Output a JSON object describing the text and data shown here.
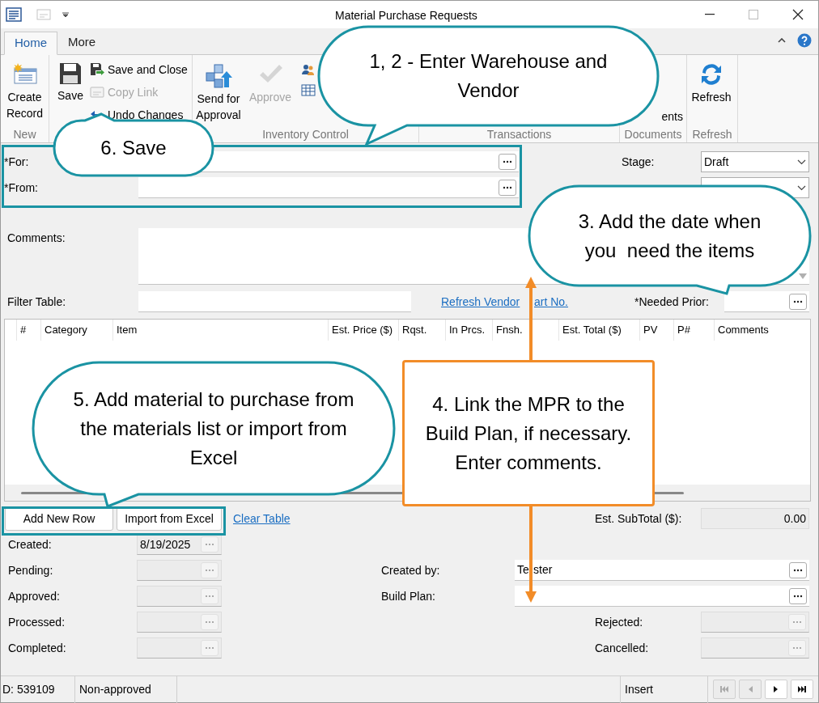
{
  "window": {
    "title": "Material Purchase Requests"
  },
  "tabs": [
    {
      "label": "Home",
      "selected": true
    },
    {
      "label": "More",
      "selected": false
    }
  ],
  "ribbon": {
    "groups": [
      {
        "label": "New",
        "buttons": [
          {
            "label": "Create Record",
            "disabled": false
          }
        ]
      },
      {
        "buttons": [
          {
            "label": "Save",
            "disabled": false
          },
          {
            "label": "Save and Close",
            "disabled": false
          },
          {
            "label": "Copy Link",
            "disabled": true
          },
          {
            "label": "Undo Changes",
            "disabled": false
          }
        ]
      },
      {
        "label": "Inventory Control",
        "buttons": [
          {
            "label": "Send for Approval",
            "disabled": false
          },
          {
            "label": "Approve",
            "disabled": true
          }
        ]
      },
      {
        "label": "Transactions"
      },
      {
        "label": "Documents",
        "buttons": [
          {
            "label": "ents",
            "disabled": false
          }
        ]
      },
      {
        "label": "Refresh",
        "buttons": [
          {
            "label": "Refresh",
            "disabled": false
          }
        ]
      }
    ]
  },
  "form": {
    "for": {
      "label": "*For:"
    },
    "from": {
      "label": "*From:"
    },
    "stage": {
      "label": "Stage:",
      "value": "Draft"
    },
    "comments": {
      "label": "Comments:"
    },
    "filter": {
      "label": "Filter Table:"
    },
    "refresh_link_parts": [
      "Refresh Vendor",
      "art No."
    ],
    "needed_prior": {
      "label": "*Needed Prior:"
    }
  },
  "table": {
    "columns": [
      "#",
      "Category",
      "Item",
      "Est. Price ($)",
      "Rqst.",
      "In Prcs.",
      "Fnsh.",
      "Est. Total ($)",
      "PV",
      "P#",
      "Comments"
    ]
  },
  "table_actions": {
    "buttons": [
      "Add New Row",
      "Import from Excel"
    ],
    "link": "Clear Table"
  },
  "subtotal": {
    "label": "Est. SubTotal ($):",
    "value": "0.00"
  },
  "dates": [
    {
      "label": "Created:",
      "value": "8/19/2025"
    },
    {
      "label": "Pending:"
    },
    {
      "label": "Approved:"
    },
    {
      "label": "Processed:"
    },
    {
      "label": "Completed:"
    }
  ],
  "details": [
    {
      "label": "Created by:",
      "value_parts": [
        "Te",
        "ster"
      ]
    },
    {
      "label": "Build Plan:"
    },
    {
      "label": "Rejected:"
    },
    {
      "label": "Cancelled:"
    }
  ],
  "status_bar": {
    "id": "D: 539109",
    "approval": "Non-approved",
    "mode": "Insert"
  },
  "callouts": [
    {
      "kind": "bubble",
      "text": "1, 2 - Enter Warehouse and Vendor"
    },
    {
      "kind": "bubble",
      "text": "6. Save"
    },
    {
      "kind": "bubble",
      "text": "3. Add the date when you  need the items"
    },
    {
      "kind": "bubble",
      "text": "5. Add material to purchase from the materials list or import from Excel"
    },
    {
      "kind": "box",
      "text": "4. Link the MPR to the Build Plan, if necessary. Enter comments."
    }
  ]
}
